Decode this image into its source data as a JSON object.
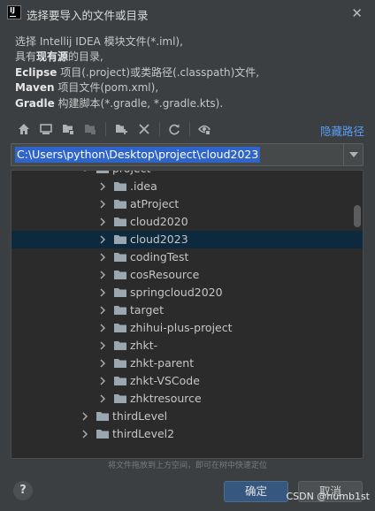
{
  "window": {
    "app_icon_text": "IJ",
    "title": "选择要导入的文件或目录"
  },
  "description": {
    "line1": "选择 Intellij IDEA 模块文件(*.iml),",
    "line2_pre": "具有",
    "line2_bold": "现有源",
    "line2_post": "的目录,",
    "line3_bold": "Eclipse",
    "line3_rest": " 项目(.project)或类路径(.classpath)文件,",
    "line4_bold": "Maven",
    "line4_rest": " 项目文件(pom.xml),",
    "line5_bold": "Gradle",
    "line5_rest": " 构建脚本(*.gradle, *.gradle.kts)."
  },
  "toolbar": {
    "icons": [
      "home-icon",
      "desktop-icon",
      "project-folder-icon",
      "module-folder-icon",
      "new-folder-icon",
      "delete-icon",
      "refresh-icon",
      "show-hidden-icon"
    ],
    "hide_path_label": "隐藏路径"
  },
  "path_field": {
    "value": "C:\\Users\\python\\Desktop\\project\\cloud2023"
  },
  "tree": {
    "items": [
      {
        "label": "project",
        "expanded": true
      },
      {
        "label": ".idea"
      },
      {
        "label": "atProject"
      },
      {
        "label": "cloud2020"
      },
      {
        "label": "cloud2023",
        "selected": true
      },
      {
        "label": "codingTest"
      },
      {
        "label": "cosResource"
      },
      {
        "label": "springcloud2020"
      },
      {
        "label": "target"
      },
      {
        "label": "zhihui-plus-project"
      },
      {
        "label": "zhkt-"
      },
      {
        "label": "zhkt-parent"
      },
      {
        "label": "zhkt-VSCode"
      },
      {
        "label": "zhktresource"
      },
      {
        "label": "thirdLevel"
      },
      {
        "label": "thirdLevel2"
      }
    ]
  },
  "drag_hint": "将文件拖放到上方空间，即可在树中快速定位",
  "buttons": {
    "help": "?",
    "ok": "确定",
    "cancel": "取消"
  },
  "watermark": "CSDN @numb1st",
  "colors": {
    "background": "#3c3f41",
    "tree_background": "#2b2b2b",
    "selection": "#0d293e",
    "path_selection": "#2f65ca",
    "link": "#589df6",
    "ok_button": "#365880"
  }
}
